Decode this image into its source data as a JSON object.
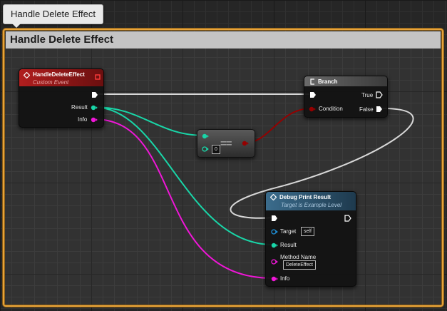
{
  "comment": {
    "bubble_label": "Handle Delete Effect",
    "header_label": "Handle Delete Effect",
    "color": "#e7a33a"
  },
  "colors": {
    "exec": "#ffffff",
    "struct_pin": "#19d6a8",
    "string_pin": "#f016d8",
    "bool_pin": "#950000",
    "object_pin": "#1f8fd6",
    "exec_wire": "#d8d8d8",
    "event_header": "#8a1414",
    "pure_header": "#5d5d5d"
  },
  "nodes": {
    "event": {
      "title": "HandleDeleteEffect",
      "subtitle": "Custom Event",
      "icon": "event-diamond-icon",
      "pins": {
        "result": "Result",
        "info": "Info"
      }
    },
    "branch": {
      "title": "Branch",
      "icon": "branch-icon",
      "pins": {
        "condition": "Condition",
        "true": "True",
        "false": "False"
      }
    },
    "equal": {
      "symbol": "==",
      "default_value": "0"
    },
    "debug": {
      "title": "Debug Print Result",
      "subtitle": "Target is Example Level",
      "icon": "function-icon",
      "pins": {
        "target": "Target",
        "target_default": "self",
        "result": "Result",
        "method_name": "Method Name",
        "method_name_value": "DeleteEffect",
        "info": "Info"
      }
    }
  }
}
